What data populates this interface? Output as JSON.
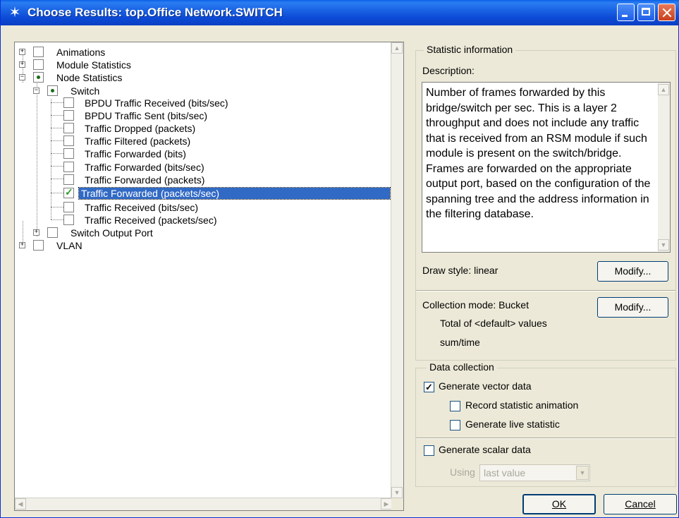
{
  "window": {
    "title": "Choose Results: top.Office Network.SWITCH"
  },
  "tree": {
    "items": [
      {
        "label": "Animations",
        "checked": false
      },
      {
        "label": "Module Statistics",
        "checked": false
      },
      {
        "label": "Node Statistics",
        "checked": "partial"
      },
      {
        "label": "Switch",
        "checked": "partial"
      },
      {
        "label": "BPDU Traffic Received (bits/sec)",
        "checked": false
      },
      {
        "label": "BPDU Traffic Sent (bits/sec)",
        "checked": false
      },
      {
        "label": "Traffic Dropped (packets)",
        "checked": false
      },
      {
        "label": "Traffic Filtered (packets)",
        "checked": false
      },
      {
        "label": "Traffic Forwarded (bits)",
        "checked": false
      },
      {
        "label": "Traffic Forwarded (bits/sec)",
        "checked": false
      },
      {
        "label": "Traffic Forwarded (packets)",
        "checked": false
      },
      {
        "label": "Traffic Forwarded (packets/sec)",
        "checked": true,
        "selected": true
      },
      {
        "label": "Traffic Received (bits/sec)",
        "checked": false
      },
      {
        "label": "Traffic Received (packets/sec)",
        "checked": false
      },
      {
        "label": "Switch Output Port",
        "checked": false
      },
      {
        "label": "VLAN",
        "checked": false
      }
    ]
  },
  "statistic_info": {
    "group_title": "Statistic information",
    "description_label": "Description:",
    "description": "Number of frames forwarded by this bridge/switch per sec. This is a layer 2 throughput and does not include any traffic that is received from an RSM module if such module is present on the switch/bridge. Frames are forwarded on the appropriate output port, based on the configuration of the spanning tree and the address information in the filtering database.",
    "draw_style": "Draw style: linear",
    "modify_label": "Modify...",
    "collection_mode": "Collection mode: Bucket",
    "total_of": "Total of <default> values",
    "sum_time": "sum/time"
  },
  "data_collection": {
    "group_title": "Data collection",
    "generate_vector": {
      "label": "Generate vector data",
      "checked": true
    },
    "record_animation": {
      "label": "Record statistic animation",
      "checked": false
    },
    "generate_live": {
      "label": "Generate live statistic",
      "checked": false
    },
    "generate_scalar": {
      "label": "Generate scalar data",
      "checked": false
    },
    "using_label": "Using",
    "using_value": "last value"
  },
  "buttons": {
    "ok": "OK",
    "cancel": "Cancel"
  },
  "icons": {
    "expand": "+",
    "collapse": "−",
    "tick": "✓"
  }
}
